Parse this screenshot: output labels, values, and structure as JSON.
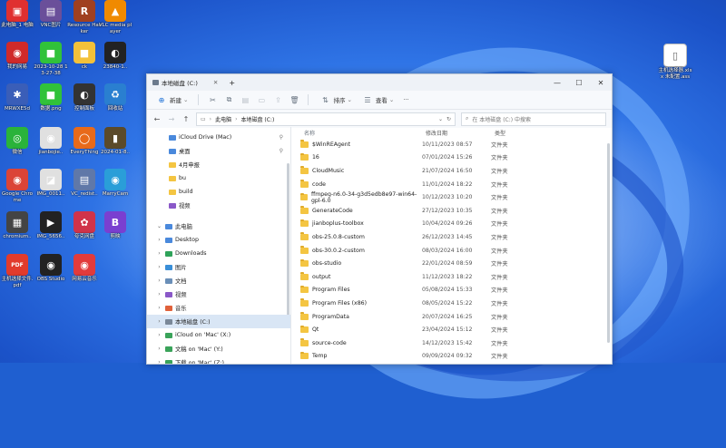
{
  "desktop": {
    "icons": [
      {
        "label": "此电脑_1 电脑",
        "color": "#e03030",
        "glyph": "▣"
      },
      {
        "label": "VNC图片",
        "color": "#6a4f9a",
        "glyph": "▤"
      },
      {
        "label": "Resource Hacker",
        "color": "#a04020",
        "glyph": "R"
      },
      {
        "label": "VLC media player",
        "color": "#f08a00",
        "glyph": "▲"
      },
      {
        "label": "我的网易",
        "color": "#d02a2a",
        "glyph": "◉"
      },
      {
        "label": "2023-10-28 13-27-38",
        "color": "#31c23a",
        "glyph": "■"
      },
      {
        "label": "ck",
        "color": "#f3c13a",
        "glyph": "■"
      },
      {
        "label": "23840-1..",
        "color": "#222",
        "glyph": "◐"
      },
      {
        "label": "MRWXE5d",
        "color": "#3a5eb8",
        "glyph": "✱"
      },
      {
        "label": "数据.png",
        "color": "#31c23a",
        "glyph": "■"
      },
      {
        "label": "控制面板",
        "color": "#333",
        "glyph": "◐"
      },
      {
        "label": "回收站",
        "color": "#2a7fd0",
        "glyph": "♻"
      },
      {
        "label": "微信",
        "color": "#2ab33a",
        "glyph": "◎"
      },
      {
        "label": "jianbojie..",
        "color": "#e0e0e0",
        "glyph": "◉"
      },
      {
        "label": "EveryThing",
        "color": "#e86a1a",
        "glyph": "◯"
      },
      {
        "label": "2024-01-8..",
        "color": "#5b4a2a",
        "glyph": "▮"
      },
      {
        "label": "Google Chrome",
        "color": "#db4437",
        "glyph": "◉"
      },
      {
        "label": "IMG_0011..",
        "color": "#e0e0e0",
        "glyph": "◪"
      },
      {
        "label": "VC_redist..",
        "color": "#6078a8",
        "glyph": "▤"
      },
      {
        "label": "MarryCam",
        "color": "#2a9ed8",
        "glyph": "◉"
      },
      {
        "label": "chromium..",
        "color": "#444",
        "glyph": "▦"
      },
      {
        "label": "IMG_5656..",
        "color": "#222",
        "glyph": "▶"
      },
      {
        "label": "夸克网盘",
        "color": "#d0334a",
        "glyph": "✿"
      },
      {
        "label": "剪映",
        "color": "#7a3fd0",
        "glyph": "B"
      },
      {
        "label": "主机选择文件.pdf",
        "color": "#e23b2c",
        "glyph": "PDF"
      },
      {
        "label": "OBS Studio",
        "color": "#222",
        "glyph": "◉"
      },
      {
        "label": "网易云音乐",
        "color": "#e23b3b",
        "glyph": "◉"
      },
      {
        "label": "设置",
        "color": "#d8d8d8",
        "glyph": "⚙"
      }
    ],
    "right_icon": {
      "label": "主机选择器.xlsx 未配置.ass",
      "glyph": "▯"
    }
  },
  "window": {
    "tab_title": "本地磁盘 (C:)",
    "add_tab": "+",
    "controls": {
      "minimize": "—",
      "maximize": "☐",
      "close": "✕"
    },
    "toolbar": {
      "new_label": "新建",
      "sort_label": "排序",
      "view_label": "查看",
      "more_label": "···"
    },
    "address": {
      "parts": [
        "此电脑",
        "本地磁盘 (C:)"
      ],
      "search_placeholder": "在 本地磁盘 (C:) 中搜索"
    },
    "sidebar": [
      {
        "label": "iCloud Drive (Mac)",
        "color": "#4a89dc",
        "pin": true,
        "chev": "",
        "sub": false,
        "sel": false
      },
      {
        "label": "桌面",
        "color": "#4a89dc",
        "pin": true,
        "chev": "",
        "sub": false,
        "sel": false
      },
      {
        "label": "4月申报",
        "color": "#f4c542",
        "pin": false,
        "chev": "",
        "sub": false,
        "sel": false
      },
      {
        "label": "bu",
        "color": "#f4c542",
        "pin": false,
        "chev": "",
        "sub": false,
        "sel": false
      },
      {
        "label": "build",
        "color": "#f4c542",
        "pin": false,
        "chev": "",
        "sub": false,
        "sel": false
      },
      {
        "label": "视频",
        "color": "#8a58c8",
        "pin": false,
        "chev": "",
        "sub": false,
        "sel": false
      },
      {
        "label": "",
        "color": "#fff",
        "pin": false,
        "chev": "",
        "sub": false,
        "sel": false
      },
      {
        "label": "此电脑",
        "color": "#4a89dc",
        "pin": false,
        "chev": "⌄",
        "sub": true,
        "sel": false
      },
      {
        "label": "Desktop",
        "color": "#4a89dc",
        "pin": false,
        "chev": "›",
        "sub": true,
        "sel": false
      },
      {
        "label": "Downloads",
        "color": "#2fa35a",
        "pin": false,
        "chev": "›",
        "sub": true,
        "sel": false
      },
      {
        "label": "图片",
        "color": "#3a8fd8",
        "pin": false,
        "chev": "›",
        "sub": true,
        "sel": false
      },
      {
        "label": "文档",
        "color": "#6a8fb8",
        "pin": false,
        "chev": "›",
        "sub": true,
        "sel": false
      },
      {
        "label": "视频",
        "color": "#8a58c8",
        "pin": false,
        "chev": "›",
        "sub": true,
        "sel": false
      },
      {
        "label": "音乐",
        "color": "#e0613a",
        "pin": false,
        "chev": "›",
        "sub": true,
        "sel": false
      },
      {
        "label": "本地磁盘 (C:)",
        "color": "#7a8898",
        "pin": false,
        "chev": "›",
        "sub": true,
        "sel": true
      },
      {
        "label": "iCloud on 'Mac' (X:)",
        "color": "#3aa35a",
        "pin": false,
        "chev": "›",
        "sub": true,
        "sel": false
      },
      {
        "label": "文稿 on 'Mac' (Y:)",
        "color": "#3aa35a",
        "pin": false,
        "chev": "›",
        "sub": true,
        "sel": false
      },
      {
        "label": "下载 on 'Mac' (Z:)",
        "color": "#3aa35a",
        "pin": false,
        "chev": "›",
        "sub": true,
        "sel": false
      }
    ],
    "columns": {
      "name": "名称",
      "date": "修改日期",
      "type": "类型"
    },
    "files": [
      {
        "name": "$WinREAgent",
        "date": "10/11/2023 08:57",
        "type": "文件夹"
      },
      {
        "name": "16",
        "date": "07/01/2024 15:26",
        "type": "文件夹"
      },
      {
        "name": "CloudMusic",
        "date": "21/07/2024 16:50",
        "type": "文件夹"
      },
      {
        "name": "code",
        "date": "11/01/2024 18:22",
        "type": "文件夹"
      },
      {
        "name": "ffmpeg-n6.0-34-g3d5edb8e97-win64-gpl-6.0",
        "date": "10/12/2023 10:20",
        "type": "文件夹"
      },
      {
        "name": "GenerateCode",
        "date": "27/12/2023 10:35",
        "type": "文件夹"
      },
      {
        "name": "jianboplus-toolbox",
        "date": "10/04/2024 09:26",
        "type": "文件夹"
      },
      {
        "name": "obs-25.0.8-custom",
        "date": "26/12/2023 14:45",
        "type": "文件夹"
      },
      {
        "name": "obs-30.0.2-custom",
        "date": "08/03/2024 16:00",
        "type": "文件夹"
      },
      {
        "name": "obs-studio",
        "date": "22/01/2024 08:59",
        "type": "文件夹"
      },
      {
        "name": "output",
        "date": "11/12/2023 18:22",
        "type": "文件夹"
      },
      {
        "name": "Program Files",
        "date": "05/08/2024 15:33",
        "type": "文件夹"
      },
      {
        "name": "Program Files (x86)",
        "date": "08/05/2024 15:22",
        "type": "文件夹"
      },
      {
        "name": "ProgramData",
        "date": "20/07/2024 16:25",
        "type": "文件夹"
      },
      {
        "name": "Qt",
        "date": "23/04/2024 15:12",
        "type": "文件夹"
      },
      {
        "name": "source-code",
        "date": "14/12/2023 15:42",
        "type": "文件夹"
      },
      {
        "name": "Temp",
        "date": "09/09/2024 09:32",
        "type": "文件夹"
      }
    ]
  }
}
